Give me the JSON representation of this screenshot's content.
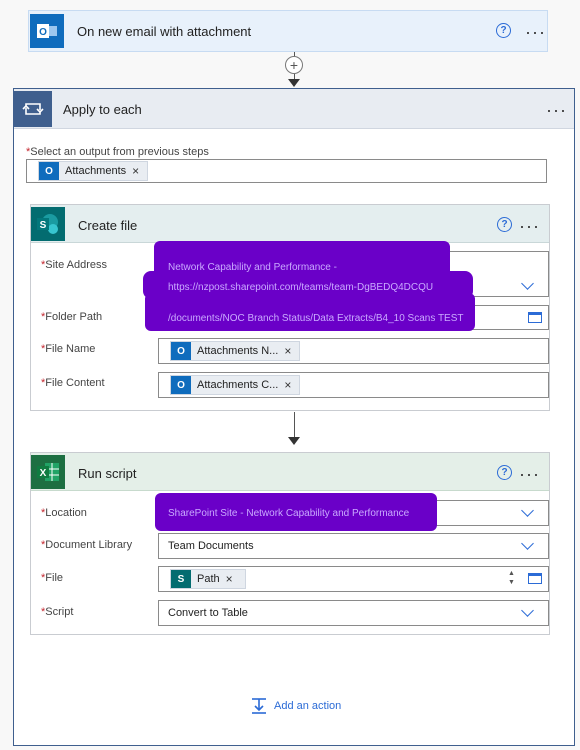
{
  "trigger": {
    "title": "On new email with attachment",
    "help_icon": "?",
    "more_icon": "···"
  },
  "apply_to_each": {
    "title": "Apply to each",
    "more_icon": "···",
    "output_label_required": "*",
    "output_label": "Select an output from previous steps",
    "output_token": "Attachments",
    "token_remove": "×"
  },
  "create_file": {
    "title": "Create file",
    "help_icon": "?",
    "more_icon": "···",
    "site_address_label": "Site Address",
    "site_address_line1": "Network Capability and Performance -",
    "site_address_line2": "https://nzpost.sharepoint.com/teams/team-DgBEDQ4DCQU",
    "folder_path_label": "Folder Path",
    "folder_path_value": "/documents/NOC Branch Status/Data Extracts/B4_10 Scans TEST",
    "file_name_label": "File Name",
    "file_name_token": "Attachments N...",
    "file_content_label": "File Content",
    "file_content_token": "Attachments C...",
    "token_remove": "×"
  },
  "run_script": {
    "title": "Run script",
    "help_icon": "?",
    "more_icon": "···",
    "location_label": "Location",
    "location_value": "SharePoint Site - Network Capability and Performance",
    "document_library_label": "Document Library",
    "document_library_value": "Team Documents",
    "file_label": "File",
    "file_token": "Path",
    "script_label": "Script",
    "script_value": "Convert to Table",
    "token_remove": "×"
  },
  "add_action": {
    "label": "Add an action"
  },
  "required_marker": "*",
  "icons": [
    "outlook-icon",
    "loop-icon",
    "sharepoint-icon",
    "excel-icon",
    "help-icon",
    "more-icon",
    "chevron-down-icon",
    "folder-icon",
    "add-action-icon",
    "plus-icon"
  ],
  "colors": {
    "outlook_blue": "#0f6cbd",
    "sharepoint_teal": "#036c70",
    "excel_green": "#1d6f42",
    "redaction_purple": "#6a00c8",
    "accent_blue": "#2b6bd6",
    "loop_header": "#3f5f8e"
  }
}
